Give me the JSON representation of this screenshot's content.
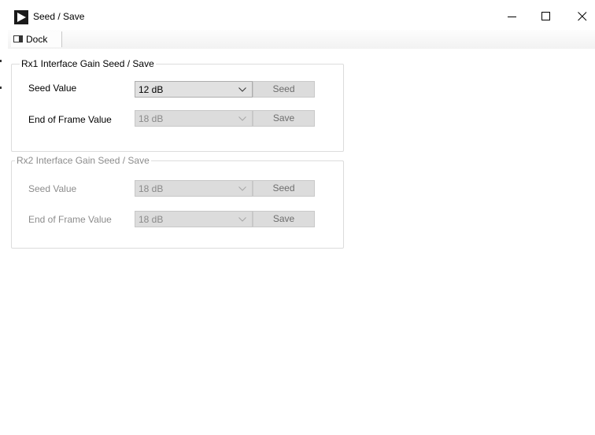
{
  "window": {
    "title": "Seed / Save",
    "minimize_icon": "minimize-icon",
    "maximize_icon": "maximize-icon",
    "close_icon": "close-icon"
  },
  "toolstrip": {
    "dock_label": "Dock"
  },
  "groups": [
    {
      "title": "Rx1 Interface Gain Seed / Save",
      "enabled": true,
      "seed_label": "Seed Value",
      "seed_value": "12 dB",
      "seed_button": "Seed",
      "eof_label": "End of Frame Value",
      "eof_value": "18 dB",
      "save_button": "Save"
    },
    {
      "title": "Rx2 Interface Gain Seed / Save",
      "enabled": false,
      "seed_label": "Seed Value",
      "seed_value": "18 dB",
      "seed_button": "Seed",
      "eof_label": "End of Frame Value",
      "eof_value": "18 dB",
      "save_button": "Save"
    }
  ],
  "colors": {
    "disabled_text": "#8c8c8c",
    "control_bg": "#dcdcdc",
    "group_border": "#dcdcdc"
  }
}
